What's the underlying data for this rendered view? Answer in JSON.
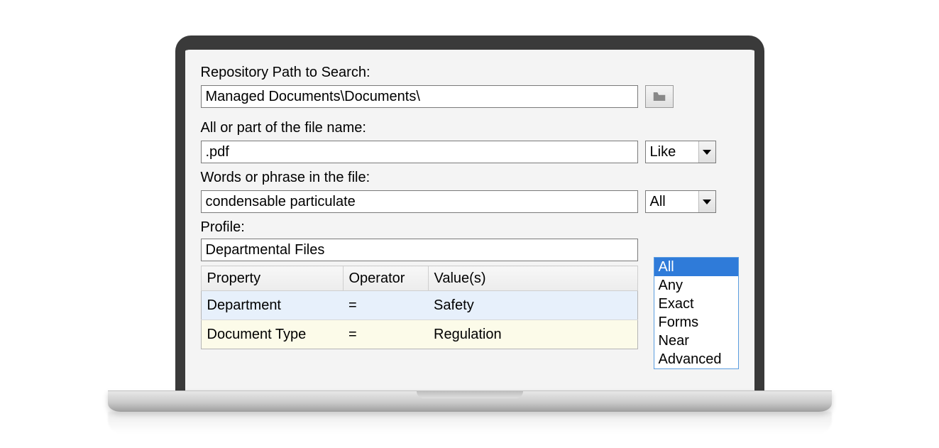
{
  "labels": {
    "repoPath": "Repository Path to Search:",
    "fileName": "All or part of the file name:",
    "words": "Words or phrase in the file:",
    "profile": "Profile:"
  },
  "values": {
    "repoPath": "Managed Documents\\Documents\\",
    "fileName": ".pdf",
    "words": "condensable particulate",
    "profile": "Departmental Files"
  },
  "combos": {
    "fileNameOp": "Like",
    "wordsOp": "All"
  },
  "dropdownOptions": [
    "All",
    "Any",
    "Exact",
    "Forms",
    "Near",
    "Advanced"
  ],
  "table": {
    "headers": [
      "Property",
      "Operator",
      "Value(s)"
    ],
    "rows": [
      {
        "property": "Department",
        "operator": "=",
        "value": "Safety"
      },
      {
        "property": "Document Type",
        "operator": "=",
        "value": "Regulation"
      }
    ]
  }
}
